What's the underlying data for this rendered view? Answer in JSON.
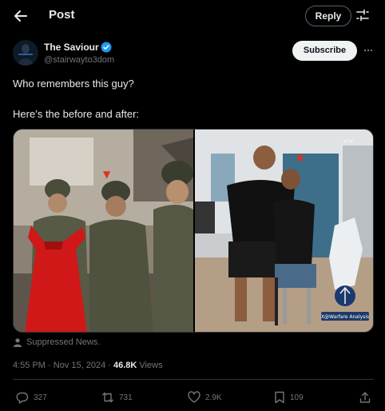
{
  "header": {
    "title": "Post",
    "reply_button": "Reply",
    "icons": [
      "back-arrow-icon",
      "adjust-icon"
    ]
  },
  "author": {
    "name": "The Saviour",
    "handle": "@stairwayto3dom",
    "verified": true,
    "subscribe_button": "Subscribe"
  },
  "tweet": {
    "line1": "Who remembers this guy?",
    "line2": "Here’s the before and after:"
  },
  "media": {
    "left_watermark_symbol": "▼",
    "right_logo_text": "ערוץ",
    "right_watermark": "X@Warfare Analysis"
  },
  "attribution": {
    "label": "Suppressed News."
  },
  "meta": {
    "time": "4:55 PM",
    "dot": "·",
    "date": "Nov 15, 2024",
    "views_count": "46.8K",
    "views_label": "Views"
  },
  "actions": {
    "replies": "327",
    "reposts": "731",
    "likes": "2.9K",
    "bookmarks": "109"
  },
  "colors": {
    "background": "#000000",
    "text": "#e7e9ea",
    "secondary": "#71767b",
    "verified": "#1d9bf0",
    "border": "#2f3336"
  }
}
